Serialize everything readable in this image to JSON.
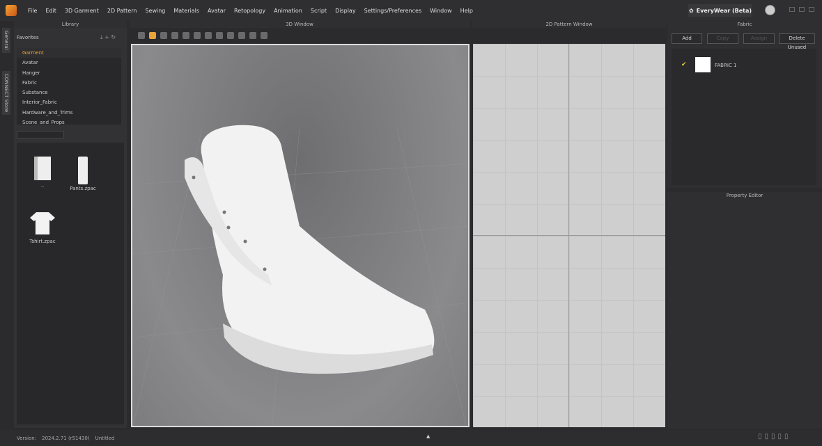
{
  "menubar": {
    "items": [
      "File",
      "Edit",
      "3D Garment",
      "2D Pattern",
      "Sewing",
      "Materials",
      "Avatar",
      "Retopology",
      "Animation",
      "Script",
      "Display",
      "Settings/Preferences",
      "Window",
      "Help"
    ],
    "brand": "EveryWear (Beta)"
  },
  "sidetabs": [
    "General",
    "CONNECT Store"
  ],
  "library": {
    "title": "Library",
    "favorites": "Favorites",
    "items": [
      "Garment",
      "Avatar",
      "Hanger",
      "Fabric",
      "Substance",
      "Interior_Fabric",
      "Hardware_and_Trims",
      "Scene_and_Props"
    ],
    "files": [
      {
        "name": "..",
        "icon": "folder-icon"
      },
      {
        "name": "Pants.zpac",
        "icon": "pants-icon"
      },
      {
        "name": "Tshirt.zpac",
        "icon": "tshirt-icon"
      }
    ]
  },
  "window3d": {
    "title": "3D Window"
  },
  "window2d": {
    "title": "2D Pattern Window"
  },
  "fabric": {
    "title": "Fabric",
    "buttons": [
      "Add",
      "Copy",
      "Assign",
      "Delete Unused"
    ],
    "items": [
      {
        "name": "FABRIC 1",
        "checked": true
      }
    ]
  },
  "property": {
    "title": "Property Editor"
  },
  "status": {
    "version_label": "Version:",
    "version": "2024.2.71 (r51430)",
    "file": "Untitled"
  },
  "colors": {
    "accent": "#e9a33a",
    "bg": "#2b2b2d"
  }
}
